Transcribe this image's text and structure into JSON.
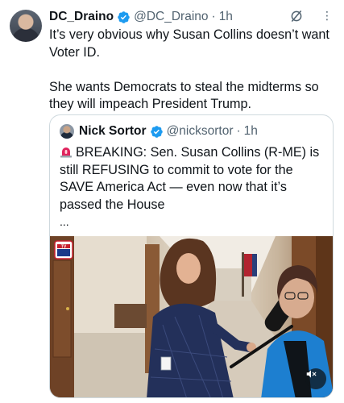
{
  "tweet": {
    "display_name": "DC_Draino",
    "handle": "@DC_Draino",
    "separator": "·",
    "time": "1h",
    "more": "⋮",
    "paragraphs": [
      "It’s very obvious why Susan Collins doesn’t want Voter ID.",
      "She wants Democrats to steal the midterms so they will impeach President Trump."
    ]
  },
  "quote": {
    "display_name": "Nick Sortor",
    "handle": "@nicksortor",
    "separator": "·",
    "time": "1h",
    "text": "BREAKING: Sen. Susan Collins (R-ME) is still REFUSING to commit to vote for the SAVE America Act — even now that it’s passed the House",
    "ellipsis": "...",
    "media_badge_text": "TV"
  },
  "colors": {
    "verified": "#1d9bf0",
    "secondary_text": "#536471",
    "border": "#cfd9de",
    "siren": "#e0245e"
  },
  "icons": {
    "verified": "verified-badge-icon",
    "grok": "grok-slash-icon",
    "more": "more-dots-icon",
    "siren": "rotating-light-icon",
    "mute": "speaker-muted-icon"
  }
}
